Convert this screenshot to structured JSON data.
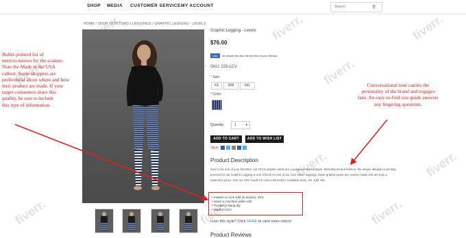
{
  "nav": {
    "items": [
      "SHOP",
      "MEDIA",
      "CUSTOMER SERVICE",
      "MY ACCOUNT"
    ],
    "search_placeholder": "Search"
  },
  "breadcrumb": "HOME / SHOP / BOTTOMS / LEGGINGS / GRAPHIC LEGGING - LEVELS",
  "product": {
    "title": "Graphic Legging - Levels",
    "price": "$76.00",
    "like_button": "Like",
    "like_text": "32 people like this. Be the first of your friends.",
    "sku": "SKU:   229 LCV",
    "size_label": "* Size:",
    "sizes": [
      "XS",
      "S/M",
      "M/L"
    ],
    "color_label": "* Color:",
    "swatch_color": "#203060",
    "quantity_label": "Quantity:",
    "quantity_value": "1",
    "add_to_cart": "ADD TO CART",
    "add_to_wishlist": "ADD TO WISH LIST",
    "pin_label": "Pin it",
    "description_title": "Product Description",
    "description": "Sure to be one of your favorites, our Onzie graphic pants are a gorgeous showstopper. Blending art and fashion, the unique allegiance-printing process for our Graphic Legging is one of kind! As one of our core Onzie leggings, these graphic pants are custom made and are truly a statement piece. See our Size Guide for more information. Available sizes: XS, S/M, M/L.",
    "bullets": [
      "Inseam on size S/M (in inches): 28.5",
      "Hand or machine wash cold",
      "Tumble or hang dry",
      "Made in USA"
    ],
    "love_text": "Love this style? Click ",
    "love_link": "HERE",
    "love_suffix": " to view more colors!",
    "reviews_title": "Product Reviews"
  },
  "annotations": {
    "left": [
      "Bullet-pointed list of",
      "need-to-knows for the scanner.",
      "Note the Made in the USA",
      "callout. Some shoppers are",
      "preferential about where and how",
      "their product are made. If your",
      "target consumers share this",
      "quality, be sure to include",
      "this type of information."
    ],
    "right": [
      "Conversational tone carries the",
      "personality of the brand and engages",
      "fans. An easy-to-find size guide answers",
      "any lingering questions."
    ],
    "color": "#d42020"
  },
  "watermark": "fiverr."
}
